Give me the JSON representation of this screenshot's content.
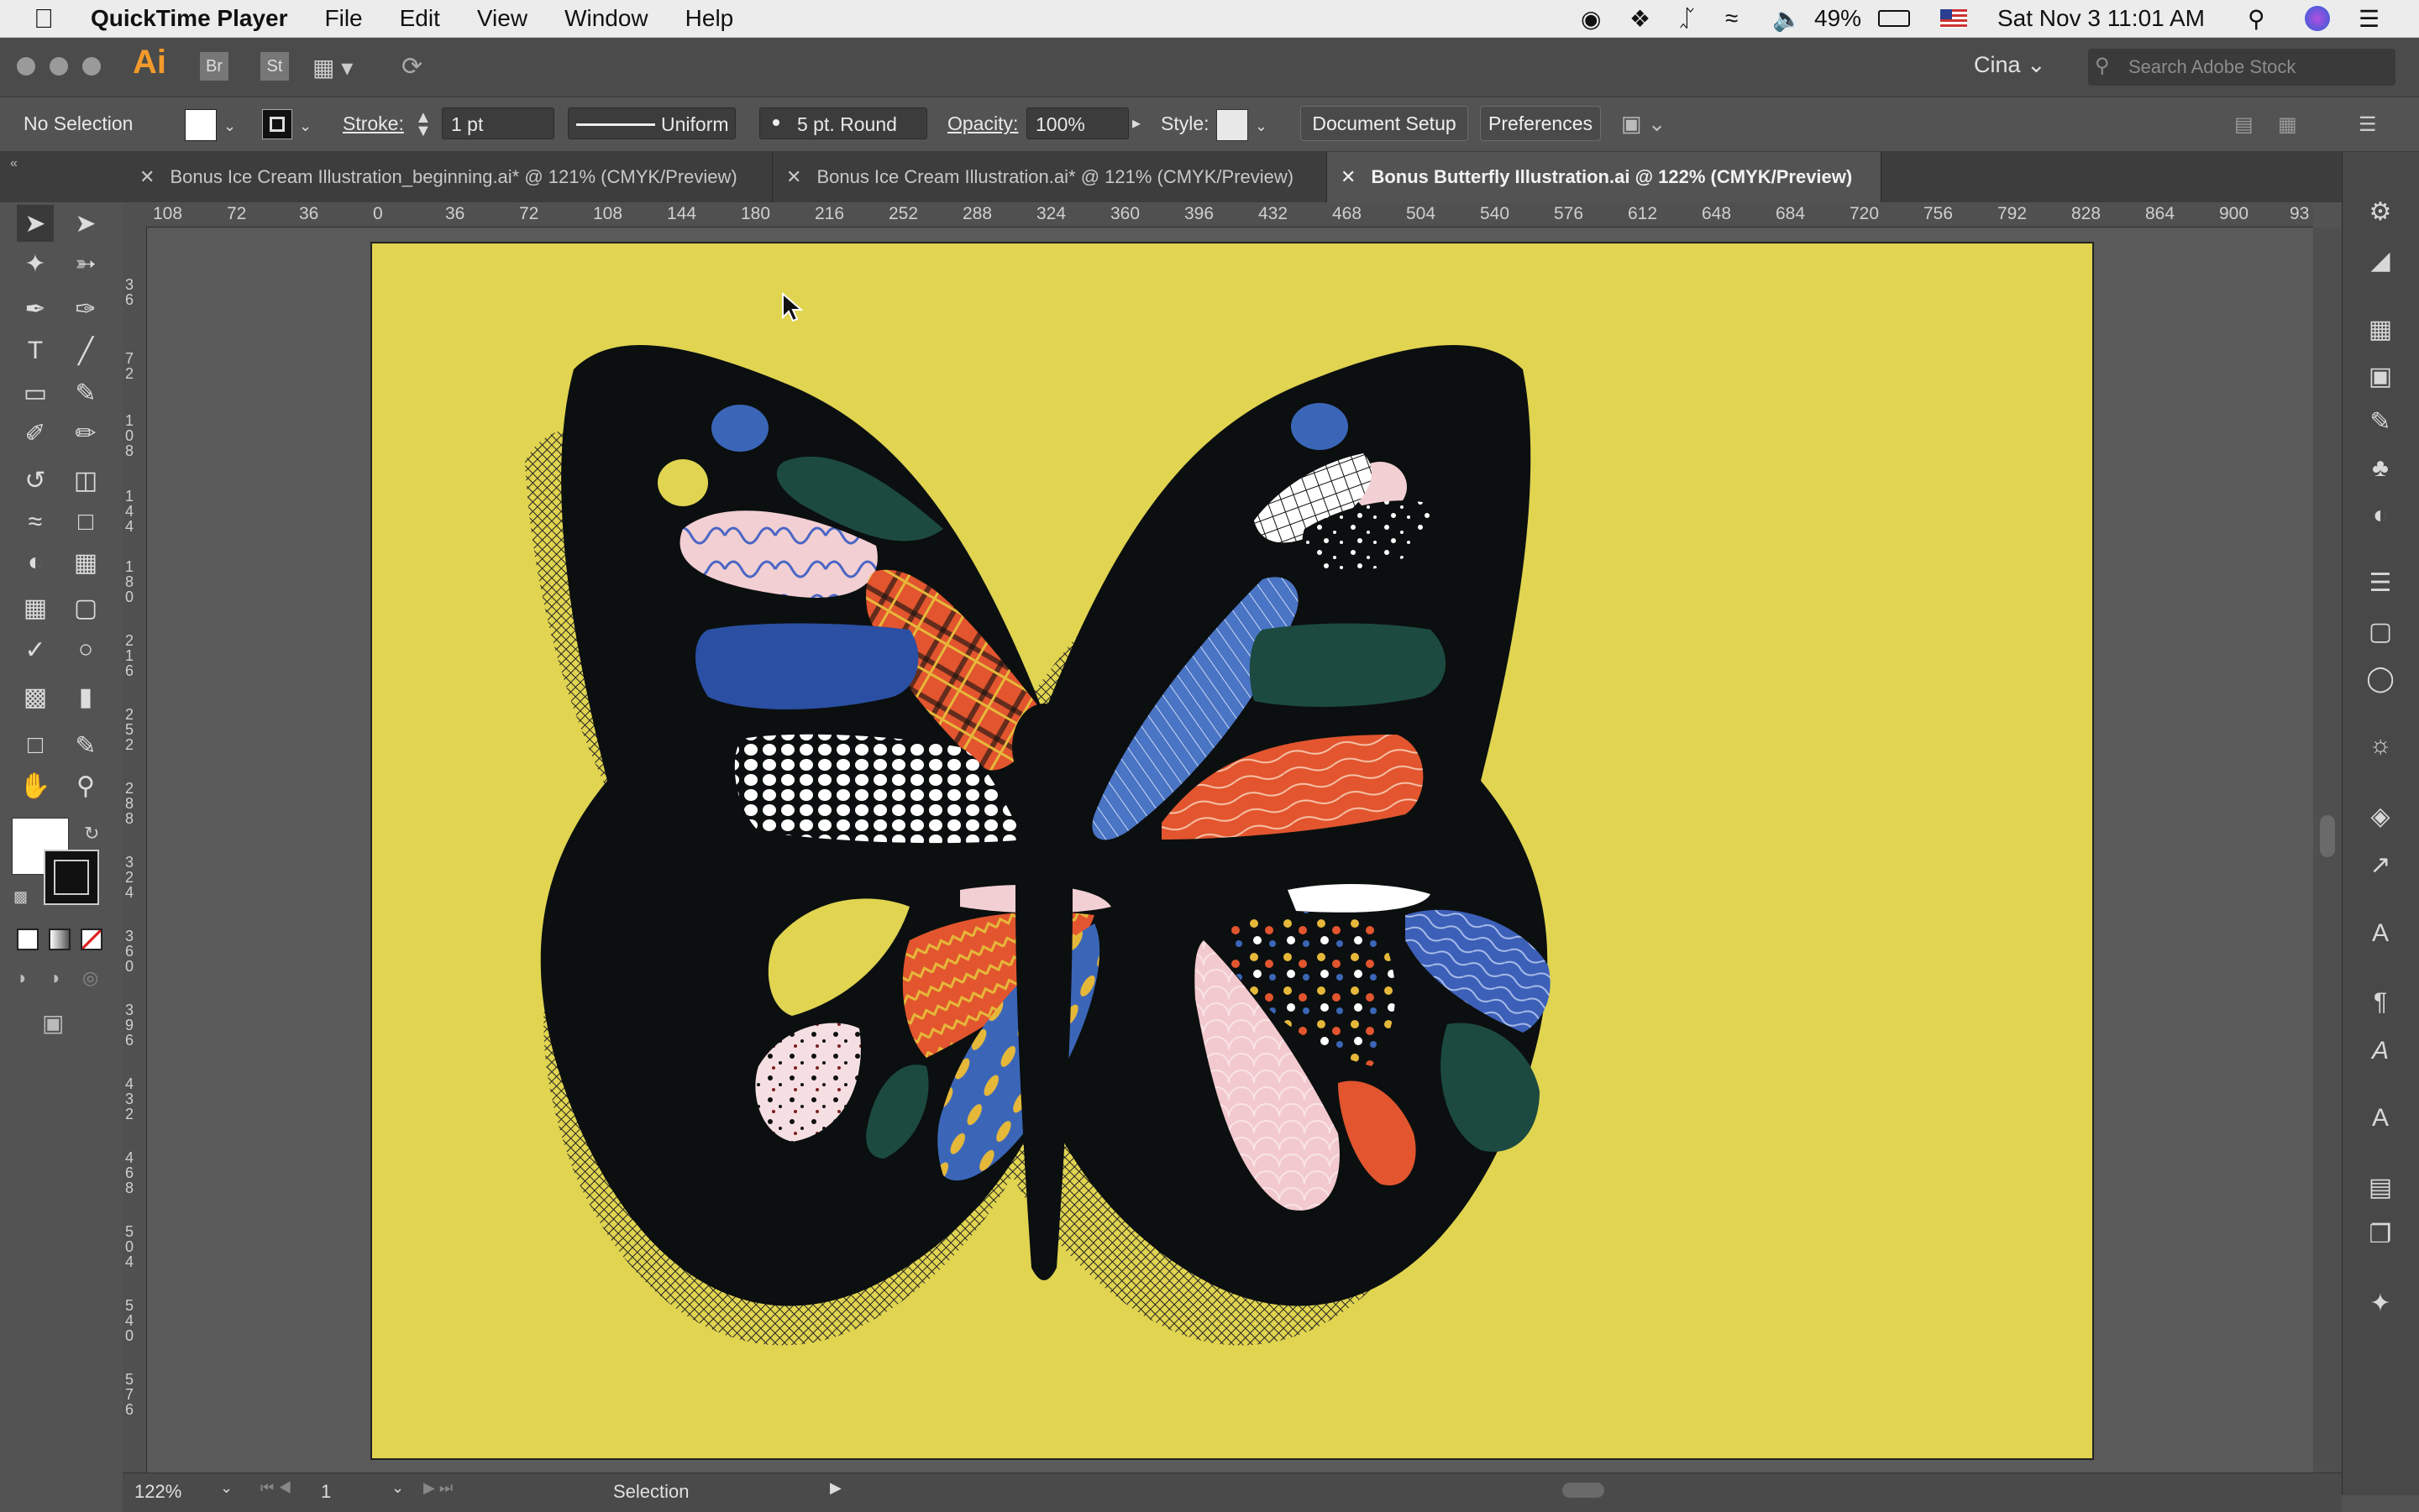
{
  "menubar": {
    "app_name": "QuickTime Player",
    "items": [
      "File",
      "Edit",
      "View",
      "Window",
      "Help"
    ],
    "battery": "49%",
    "datetime": "Sat Nov 3  11:01 AM"
  },
  "appbar": {
    "app_logo": "Ai",
    "bridge": "Br",
    "stock": "St",
    "workspace": "Cina",
    "search_placeholder": "Search Adobe Stock"
  },
  "control": {
    "selection": "No Selection",
    "stroke_label": "Stroke:",
    "stroke_value": "1 pt",
    "profile": "Uniform",
    "brush": "5 pt. Round",
    "opacity_label": "Opacity:",
    "opacity_value": "100%",
    "style_label": "Style:",
    "document_setup": "Document Setup",
    "preferences": "Preferences"
  },
  "tabs": [
    {
      "label": "Bonus Ice Cream Illustration_beginning.ai* @ 121% (CMYK/Preview)",
      "active": false
    },
    {
      "label": "Bonus Ice Cream Illustration.ai* @ 121% (CMYK/Preview)",
      "active": false
    },
    {
      "label": "Bonus Butterfly Illustration.ai @ 122% (CMYK/Preview)",
      "active": true
    }
  ],
  "ruler": {
    "h_ticks": [
      "108",
      "72",
      "36",
      "0",
      "36",
      "72",
      "108",
      "144",
      "180",
      "216",
      "252",
      "288",
      "324",
      "360",
      "396",
      "432",
      "468",
      "504",
      "540",
      "576",
      "612",
      "648",
      "684",
      "720",
      "756",
      "792",
      "828",
      "864",
      "900",
      "93"
    ],
    "v_ticks": [
      "36",
      "72",
      "108",
      "144",
      "180",
      "216",
      "252",
      "288",
      "324",
      "360",
      "396",
      "432",
      "468",
      "504",
      "540",
      "576"
    ]
  },
  "status": {
    "zoom": "122%",
    "artboard": "1",
    "tool": "Selection"
  },
  "colors": {
    "artboard_bg": "#e0d451",
    "butterfly_body": "#0b0f0f",
    "blue": "#2a4fa3",
    "orange": "#e2552e",
    "pink": "#f2cfd3",
    "teal": "#1c4a40",
    "yellow_leaf": "#e6b83a"
  }
}
